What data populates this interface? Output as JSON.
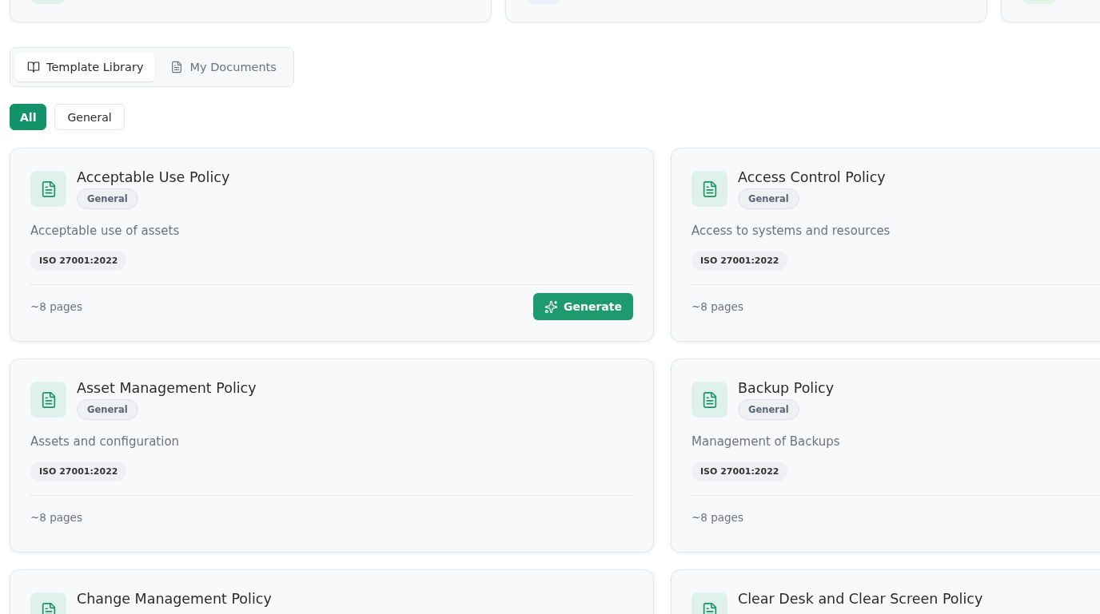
{
  "stats": [
    {
      "color": "#e3f3ec"
    },
    {
      "color": "#eceef9"
    },
    {
      "color": "#e4f4e8"
    }
  ],
  "tabs": [
    {
      "label": "Template Library",
      "selected": true
    },
    {
      "label": "My Documents",
      "selected": false
    }
  ],
  "filters": [
    {
      "label": "All",
      "selected": true
    },
    {
      "label": "General",
      "selected": false
    }
  ],
  "templates": [
    {
      "title": "Acceptable Use Policy",
      "category": "General",
      "description": "Acceptable use of assets",
      "standard": "ISO 27001:2022",
      "pages": "~8 pages",
      "action": "Generate"
    },
    {
      "title": "Access Control Policy",
      "category": "General",
      "description": "Access to systems and resources",
      "standard": "ISO 27001:2022",
      "pages": "~8 pages"
    },
    {
      "title": "Asset Management Policy",
      "category": "General",
      "description": "Assets and configuration",
      "standard": "ISO 27001:2022",
      "pages": "~8 pages"
    },
    {
      "title": "Backup Policy",
      "category": "General",
      "description": "Management of Backups",
      "standard": "ISO 27001:2022",
      "pages": "~8 pages"
    },
    {
      "title": "Change Management Policy"
    },
    {
      "title": "Clear Desk and Clear Screen Policy"
    }
  ]
}
